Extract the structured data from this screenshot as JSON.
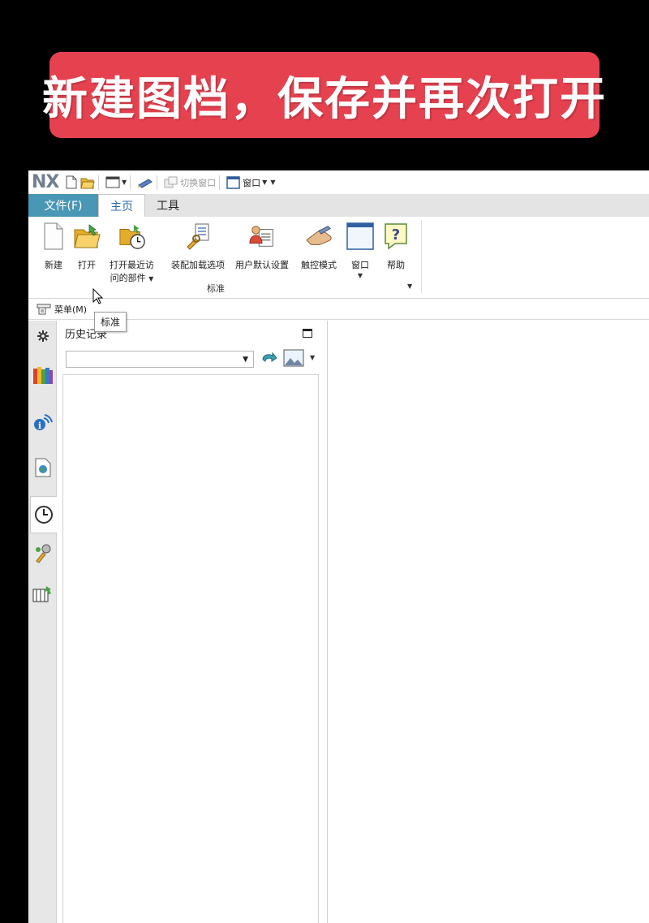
{
  "banner": {
    "text": "新建图档，保存并再次打开"
  },
  "app": {
    "logo": "NX",
    "quick_access": {
      "switch_window_label": "切换窗口",
      "window_label": "窗口"
    },
    "tabs": [
      {
        "label": "文件(F)"
      },
      {
        "label": "主页"
      },
      {
        "label": "工具"
      }
    ],
    "ribbon": {
      "buttons": {
        "new": "新建",
        "open": "打开",
        "recent_line1": "打开最近访",
        "recent_line2": "问的部件",
        "assembly_load": "装配加载选项",
        "user_defaults": "用户默认设置",
        "touch_mode": "触控模式",
        "window": "窗口",
        "help": "帮助"
      },
      "group_label": "标准"
    },
    "menubar": {
      "menu_label": "菜单(M)"
    },
    "tooltip": "标准",
    "history_panel": {
      "title": "历史记录"
    }
  },
  "colors": {
    "banner": "#e5414f",
    "file_tab": "#4a97b5",
    "active_tab_text": "#2b6da8"
  }
}
